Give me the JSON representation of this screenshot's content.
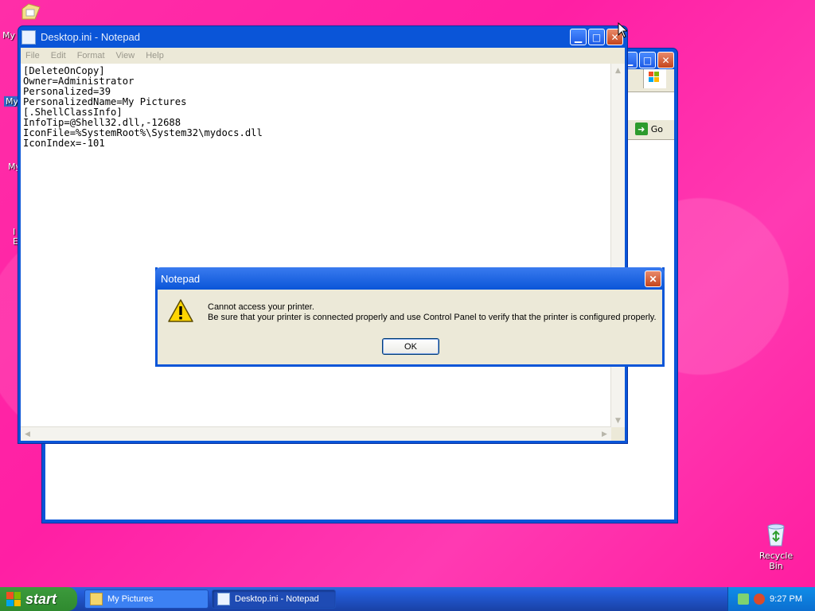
{
  "desktop": {
    "icons": [
      {
        "label": "My I"
      },
      {
        "label": "My"
      },
      {
        "label": "My"
      },
      {
        "label": "I E"
      },
      {
        "label": "Recycle Bin"
      }
    ]
  },
  "bg_window": {
    "go_label": "Go"
  },
  "notepad": {
    "title": "Desktop.ini - Notepad",
    "menu": [
      "File",
      "Edit",
      "Format",
      "View",
      "Help"
    ],
    "content": "[DeleteOnCopy]\nOwner=Administrator\nPersonalized=39\nPersonalizedName=My Pictures\n[.ShellClassInfo]\nInfoTip=@Shell32.dll,-12688\nIconFile=%SystemRoot%\\System32\\mydocs.dll\nIconIndex=-101"
  },
  "dialog": {
    "title": "Notepad",
    "line1": "Cannot access your printer.",
    "line2": "Be sure that your printer is connected properly and use Control Panel to verify that the printer is configured properly.",
    "ok_label": "OK",
    "icon": "warning-icon"
  },
  "taskbar": {
    "start_label": "start",
    "tasks": [
      {
        "label": "My Pictures",
        "active": false
      },
      {
        "label": "Desktop.ini - Notepad",
        "active": true
      }
    ],
    "clock": "9:27 PM"
  },
  "colors": {
    "desktop": "#ff1fa4",
    "xp_blue": "#0a55d8",
    "start_green": "#3c9a3c"
  }
}
